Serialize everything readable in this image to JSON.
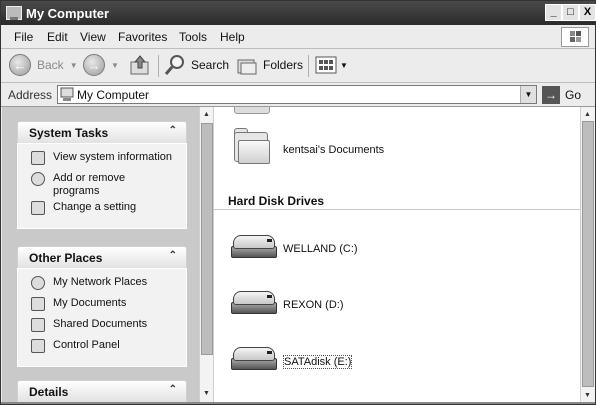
{
  "window": {
    "title": "My Computer",
    "controls": {
      "minimize": "_",
      "maximize": "□",
      "close": "X"
    }
  },
  "menubar": {
    "items": [
      {
        "label": "File"
      },
      {
        "label": "Edit"
      },
      {
        "label": "View"
      },
      {
        "label": "Favorites"
      },
      {
        "label": "Tools"
      },
      {
        "label": "Help"
      }
    ]
  },
  "toolbar": {
    "back_label": "Back",
    "search_label": "Search",
    "folders_label": "Folders"
  },
  "address": {
    "label": "Address",
    "value": "My Computer",
    "go_label": "Go"
  },
  "taskpane": {
    "system_tasks": {
      "title": "System Tasks",
      "items": [
        {
          "label": "View system information",
          "icon": "system-info-icon"
        },
        {
          "label": "Add or remove programs",
          "icon": "add-remove-icon"
        },
        {
          "label": "Change a setting",
          "icon": "control-panel-icon"
        }
      ]
    },
    "other_places": {
      "title": "Other Places",
      "items": [
        {
          "label": "My Network Places",
          "icon": "network-icon"
        },
        {
          "label": "My Documents",
          "icon": "documents-icon"
        },
        {
          "label": "Shared Documents",
          "icon": "folder-icon"
        },
        {
          "label": "Control Panel",
          "icon": "control-panel-icon"
        }
      ]
    },
    "details": {
      "title": "Details"
    }
  },
  "content": {
    "folders": [
      {
        "label": "kentsai's Documents"
      }
    ],
    "hard_disk_section": "Hard Disk Drives",
    "drives": [
      {
        "label": "WELLAND (C:)"
      },
      {
        "label": "REXON (D:)"
      },
      {
        "label": "SATAdisk (E:)"
      }
    ]
  }
}
